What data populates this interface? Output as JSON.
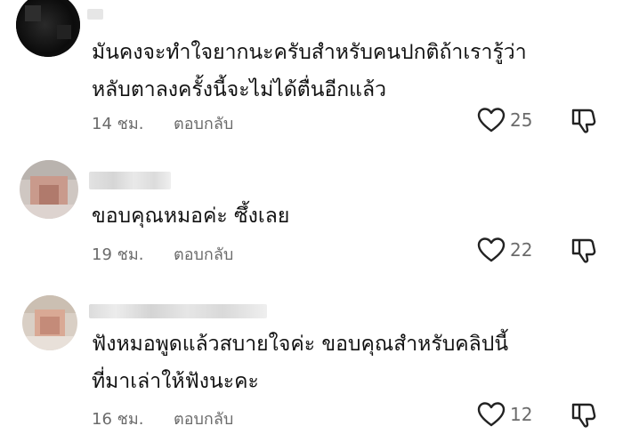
{
  "comments": [
    {
      "lines": [
        "มันคงจะทำใจยากนะครับสำหรับคนปกติถ้าเรารู้ว่า",
        "หลับตาลงครั้งนี้จะไม่ได้ตื่นอีกแล้ว"
      ],
      "time": "14 ชม.",
      "reply": "ตอบกลับ",
      "likes": "25"
    },
    {
      "lines": [
        "ขอบคุณหมอค่ะ ซึ้งเลย"
      ],
      "time": "19 ชม.",
      "reply": "ตอบกลับ",
      "likes": "22"
    },
    {
      "lines": [
        "ฟังหมอพูดแล้วสบายใจค่ะ ขอบคุณสำหรับคลิปนี้",
        "ที่มาเล่าให้ฟังนะคะ"
      ],
      "time": "16 ชม.",
      "reply": "ตอบกลับ",
      "likes": "12"
    }
  ],
  "icons": {
    "like": "heart-outline-icon",
    "dislike": "thumbs-down-outline-icon"
  },
  "colors": {
    "text": "#121212",
    "meta": "#6b6b6b",
    "background": "#ffffff"
  }
}
